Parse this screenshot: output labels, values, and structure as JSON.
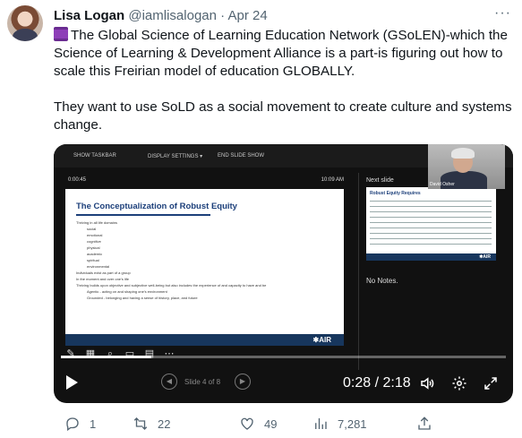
{
  "tweet": {
    "author_name": "Lisa Logan",
    "handle": "@iamlisalogan",
    "separator": "·",
    "date": "Apr 24",
    "more_label": "···",
    "text_p1": "The Global Science of Learning Education Network (GSoLEN)-which the Science of Learning & Development Alliance is a part-is figuring out how to scale this Freirian model of education GLOBALLY.",
    "text_p2": "They want to use SoLD as a social movement to create culture and systems change."
  },
  "video": {
    "toolbar": {
      "show_taskbar": "SHOW TASKBAR",
      "display_settings": "DISPLAY SETTINGS ▾",
      "end_slide_show": "END SLIDE SHOW"
    },
    "elapsed": "0:00:45",
    "clock": "10:09 AM",
    "slide_title": "The Conceptualization of Robust Equity",
    "slide_lines": [
      "Thriving in all life domains",
      "social",
      "emotional",
      "cognitive",
      "physical",
      "academic",
      "spiritual",
      "environmental",
      "Individuals exist as part of a group",
      "In the moment and over one's life",
      "Thriving builds upon objective and subjective well-being but also includes the experience of and capacity to have and be",
      "Agentic - acting on and shaping one's environment",
      "Grounded - belonging and having a sense of history, place, and future"
    ],
    "slide_logo": "✱AIR",
    "next_label": "Next slide",
    "next_slide_title": "Robust Equity Requires",
    "next_slide_logo": "✱AIR",
    "notes": "No Notes.",
    "presenter_caption": "David Osher",
    "slide_nav_label": "Slide 4 of 8",
    "time_current": "0:28",
    "time_total": "2:18",
    "timecode": "0:28 / 2:18",
    "progress_fraction": 0.203
  },
  "actions": {
    "replies": "1",
    "retweets": "22",
    "likes": "49",
    "views": "7,281"
  },
  "icons": [
    "reply-icon",
    "retweet-icon",
    "like-icon",
    "views-icon",
    "share-icon",
    "play-icon",
    "volume-icon",
    "settings-icon",
    "fullscreen-icon"
  ]
}
